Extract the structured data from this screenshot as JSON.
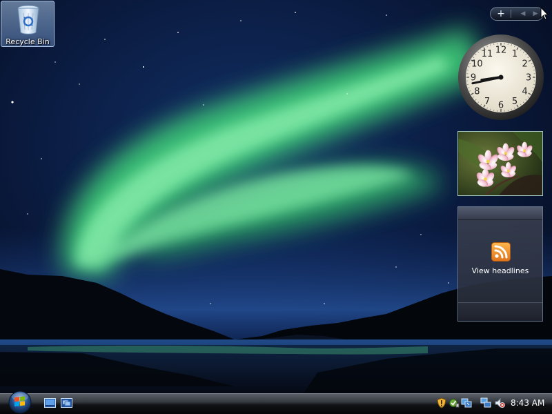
{
  "desktop": {
    "icons": [
      {
        "label": "Recycle Bin",
        "icon": "recycle-bin-icon",
        "selected": true
      }
    ]
  },
  "sidebar": {
    "controls": {
      "add": "+",
      "prev": "◀",
      "next": "▶"
    },
    "clock": {
      "numerals": [
        "12",
        "1",
        "2",
        "3",
        "4",
        "5",
        "6",
        "7",
        "8",
        "9",
        "10",
        "11"
      ],
      "time_shown": "8:43"
    },
    "slideshow": {
      "image": "pink-flowers-photo"
    },
    "feed": {
      "icon": "rss-feed-icon",
      "label": "View headlines"
    }
  },
  "taskbar": {
    "start": {
      "icon": "windows-orb-icon"
    },
    "quick_launch": [
      {
        "icon": "show-desktop-icon"
      },
      {
        "icon": "switch-windows-icon"
      }
    ],
    "tray": {
      "icons": [
        "security-shield-icon",
        "windows-defender-icon",
        "network-status-icon",
        "network-icon",
        "volume-muted-icon"
      ],
      "time": "8:43 AM"
    }
  },
  "colors": {
    "aurora": "#5fe08a",
    "sky": "#0b1a3c",
    "taskbar": "#1a1d22",
    "feed_orange": "#f0902a"
  }
}
